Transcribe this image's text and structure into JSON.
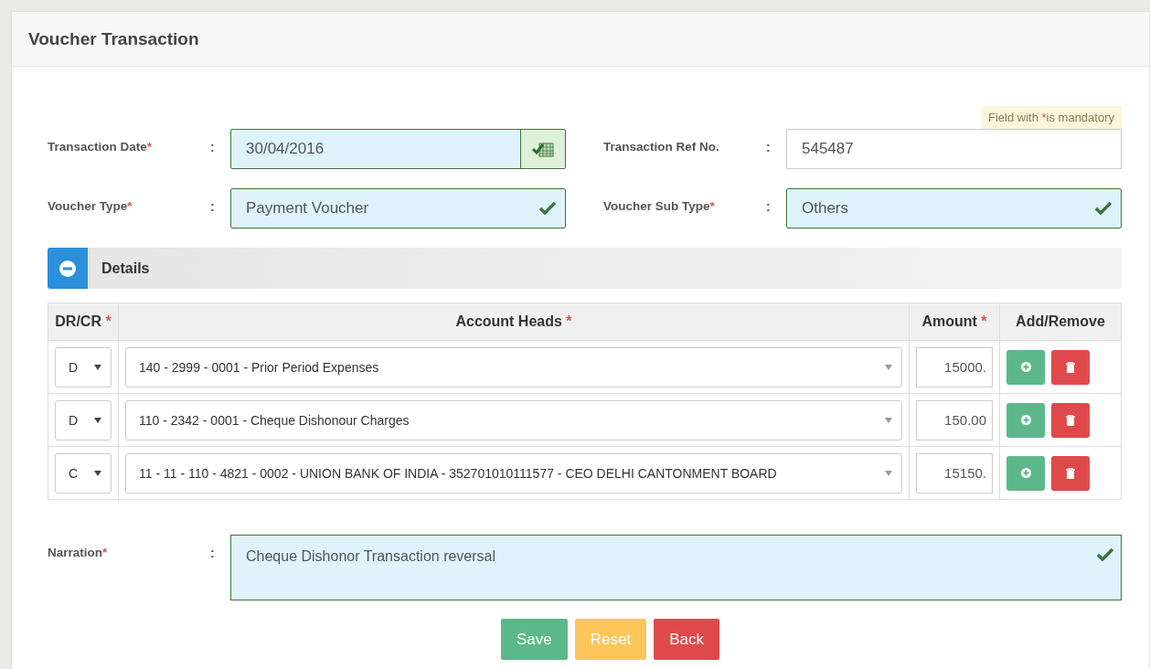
{
  "title": "Voucher Transaction",
  "mandatory_note": {
    "before": "Field with",
    "mark": "*",
    "after": "is mandatory"
  },
  "fields": [
    {
      "label": "Transaction Date",
      "mark": "*",
      "separator": ":",
      "value": "30/04/2016",
      "kind": "date",
      "valid": true
    },
    {
      "label": "Transaction Ref No.",
      "separator": ":",
      "value": "545487",
      "kind": "text",
      "valid": false
    },
    {
      "label": "Voucher Type",
      "mark": "*",
      "separator": ":",
      "value": "Payment Voucher",
      "kind": "select",
      "valid": true
    },
    {
      "label": "Voucher Sub Type",
      "mark": "*",
      "separator": ":",
      "value": "Others",
      "kind": "select",
      "valid": true
    }
  ],
  "details": {
    "title": "Details",
    "expanded": true,
    "columns": [
      {
        "label": "DR/CR",
        "mark": "*"
      },
      {
        "label": "Account Heads",
        "mark": "*"
      },
      {
        "label": "Amount",
        "mark": "*"
      },
      {
        "label": "Add/Remove"
      }
    ],
    "rows": [
      {
        "dr_cr": "D",
        "account": "140 - 2999 - 0001 - Prior Period Expenses",
        "amount": "15000."
      },
      {
        "dr_cr": "D",
        "account": "110 - 2342 - 0001 - Cheque Dishonour Charges",
        "amount": "150.00"
      },
      {
        "dr_cr": "C",
        "account": "11 - 11 - 110 - 4821 - 0002 - UNION BANK OF INDIA - 352701010111577 - CEO DELHI CANTONMENT BOARD",
        "amount": "15150."
      }
    ]
  },
  "narration": {
    "label": "Narration",
    "mark": "*",
    "separator": ":",
    "value": "Cheque Dishonor Transaction reversal",
    "valid": true
  },
  "buttons": [
    {
      "label": "Save",
      "kind": "save"
    },
    {
      "label": "Reset",
      "kind": "reset"
    },
    {
      "label": "Back",
      "kind": "back"
    }
  ]
}
